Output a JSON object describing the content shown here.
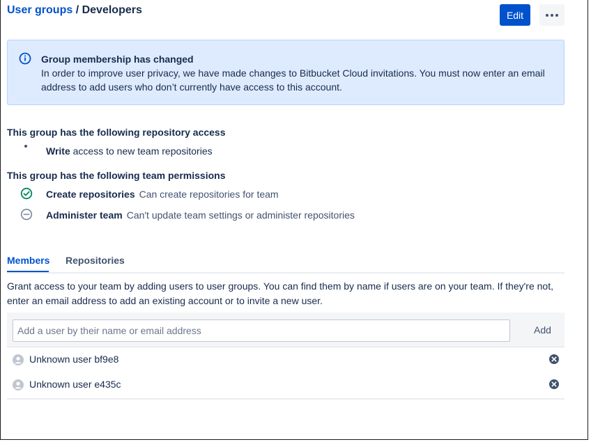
{
  "breadcrumb": {
    "parent": "User groups",
    "separator": " / ",
    "current": "Developers"
  },
  "toolbar": {
    "edit_label": "Edit",
    "more_icon": "ellipsis-icon"
  },
  "banner": {
    "title": "Group membership has changed",
    "body": "In order to improve user privacy, we have made changes to Bitbucket Cloud invitations. You must now enter an email address to add users who don’t currently have access to this account.",
    "icon": "info-icon",
    "bg_color": "#deebff"
  },
  "repo_access": {
    "title": "This group has the following repository access",
    "items": [
      {
        "bold": "Write",
        "text": " access to new team repositories"
      }
    ]
  },
  "team_permissions": {
    "title": "This group has the following team permissions",
    "items": [
      {
        "icon": "check-circle-icon",
        "label": "Create repositories",
        "desc": "Can create repositories for team",
        "color": "#00875a"
      },
      {
        "icon": "minus-circle-icon",
        "label": "Administer team",
        "desc": "Can't update team settings or administer repositories",
        "color": "#7a869a"
      }
    ]
  },
  "tabs": [
    {
      "label": "Members",
      "active": true
    },
    {
      "label": "Repositories",
      "active": false
    }
  ],
  "members_panel": {
    "description": "Grant access to your team by adding users to user groups. You can find them by name if users are on your team. If they're not, enter an email address to add an existing account or to invite a new user.",
    "input_placeholder": "Add a user by their name or email address",
    "input_value": "",
    "add_label": "Add",
    "members": [
      {
        "name": "Unknown user bf9e8"
      },
      {
        "name": "Unknown user e435c"
      }
    ]
  },
  "colors": {
    "primary": "#0052cc",
    "text": "#172b4d",
    "subtle": "#42526e"
  }
}
